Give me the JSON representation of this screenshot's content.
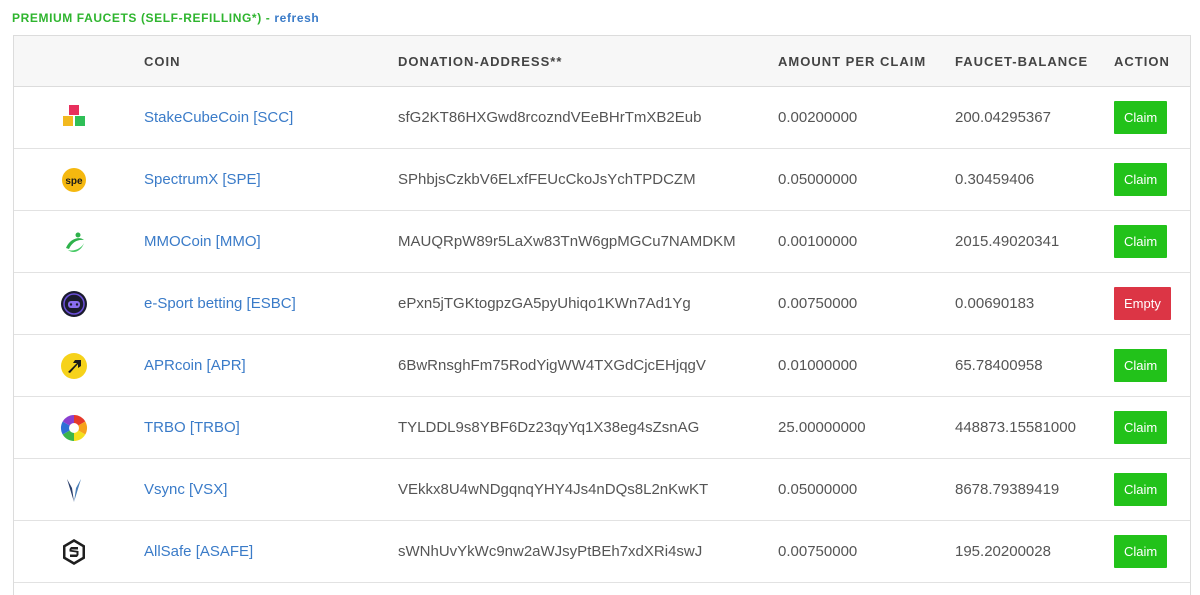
{
  "section": {
    "title": "PREMIUM FAUCETS (SELF-REFILLING*)",
    "separator": "-",
    "refresh_label": "refresh"
  },
  "table": {
    "headers": {
      "coin": "COIN",
      "address": "DONATION-ADDRESS**",
      "amount": "AMOUNT PER CLAIM",
      "balance": "FAUCET-BALANCE",
      "action": "ACTION"
    },
    "rows": [
      {
        "icon": "stakecube-icon",
        "coin": "StakeCubeCoin [SCC]",
        "address": "sfG2KT86HXGwd8rcozndVEeBHrTmXB2Eub",
        "amount": "0.00200000",
        "balance": "200.04295367",
        "action": "Claim",
        "action_type": "claim"
      },
      {
        "icon": "spectrumx-icon",
        "coin": "SpectrumX [SPE]",
        "address": "SPhbjsCzkbV6ELxfFEUcCkoJsYchTPDCZM",
        "amount": "0.05000000",
        "balance": "0.30459406",
        "action": "Claim",
        "action_type": "claim"
      },
      {
        "icon": "mmocoin-icon",
        "coin": "MMOCoin [MMO]",
        "address": "MAUQRpW89r5LaXw83TnW6gpMGCu7NAMDKM",
        "amount": "0.00100000",
        "balance": "2015.49020341",
        "action": "Claim",
        "action_type": "claim"
      },
      {
        "icon": "esport-betting-icon",
        "coin": "e-Sport betting [ESBC]",
        "address": "ePxn5jTGKtogpzGA5pyUhiqo1KWn7Ad1Yg",
        "amount": "0.00750000",
        "balance": "0.00690183",
        "action": "Empty",
        "action_type": "empty"
      },
      {
        "icon": "aprcoin-icon",
        "coin": "APRcoin [APR]",
        "address": "6BwRnsghFm75RodYigWW4TXGdCjcEHjqgV",
        "amount": "0.01000000",
        "balance": "65.78400958",
        "action": "Claim",
        "action_type": "claim"
      },
      {
        "icon": "trbo-icon",
        "coin": "TRBO [TRBO]",
        "address": "TYLDDL9s8YBF6Dz23qyYq1X38eg4sZsnAG",
        "amount": "25.00000000",
        "balance": "448873.15581000",
        "action": "Claim",
        "action_type": "claim"
      },
      {
        "icon": "vsync-icon",
        "coin": "Vsync [VSX]",
        "address": "VEkkx8U4wNDgqnqYHY4Js4nDQs8L2nKwKT",
        "amount": "0.05000000",
        "balance": "8678.79389419",
        "action": "Claim",
        "action_type": "claim"
      },
      {
        "icon": "allsafe-icon",
        "coin": "AllSafe [ASAFE]",
        "address": "sWNhUvYkWc9nw2aWJsyPtBEh7xdXRi4swJ",
        "amount": "0.00750000",
        "balance": "195.20200028",
        "action": "Claim",
        "action_type": "claim"
      }
    ]
  },
  "colors": {
    "title_green": "#2fb52f",
    "link_blue": "#3a7bc8",
    "claim_green": "#22c21a",
    "empty_red": "#dc3545"
  }
}
